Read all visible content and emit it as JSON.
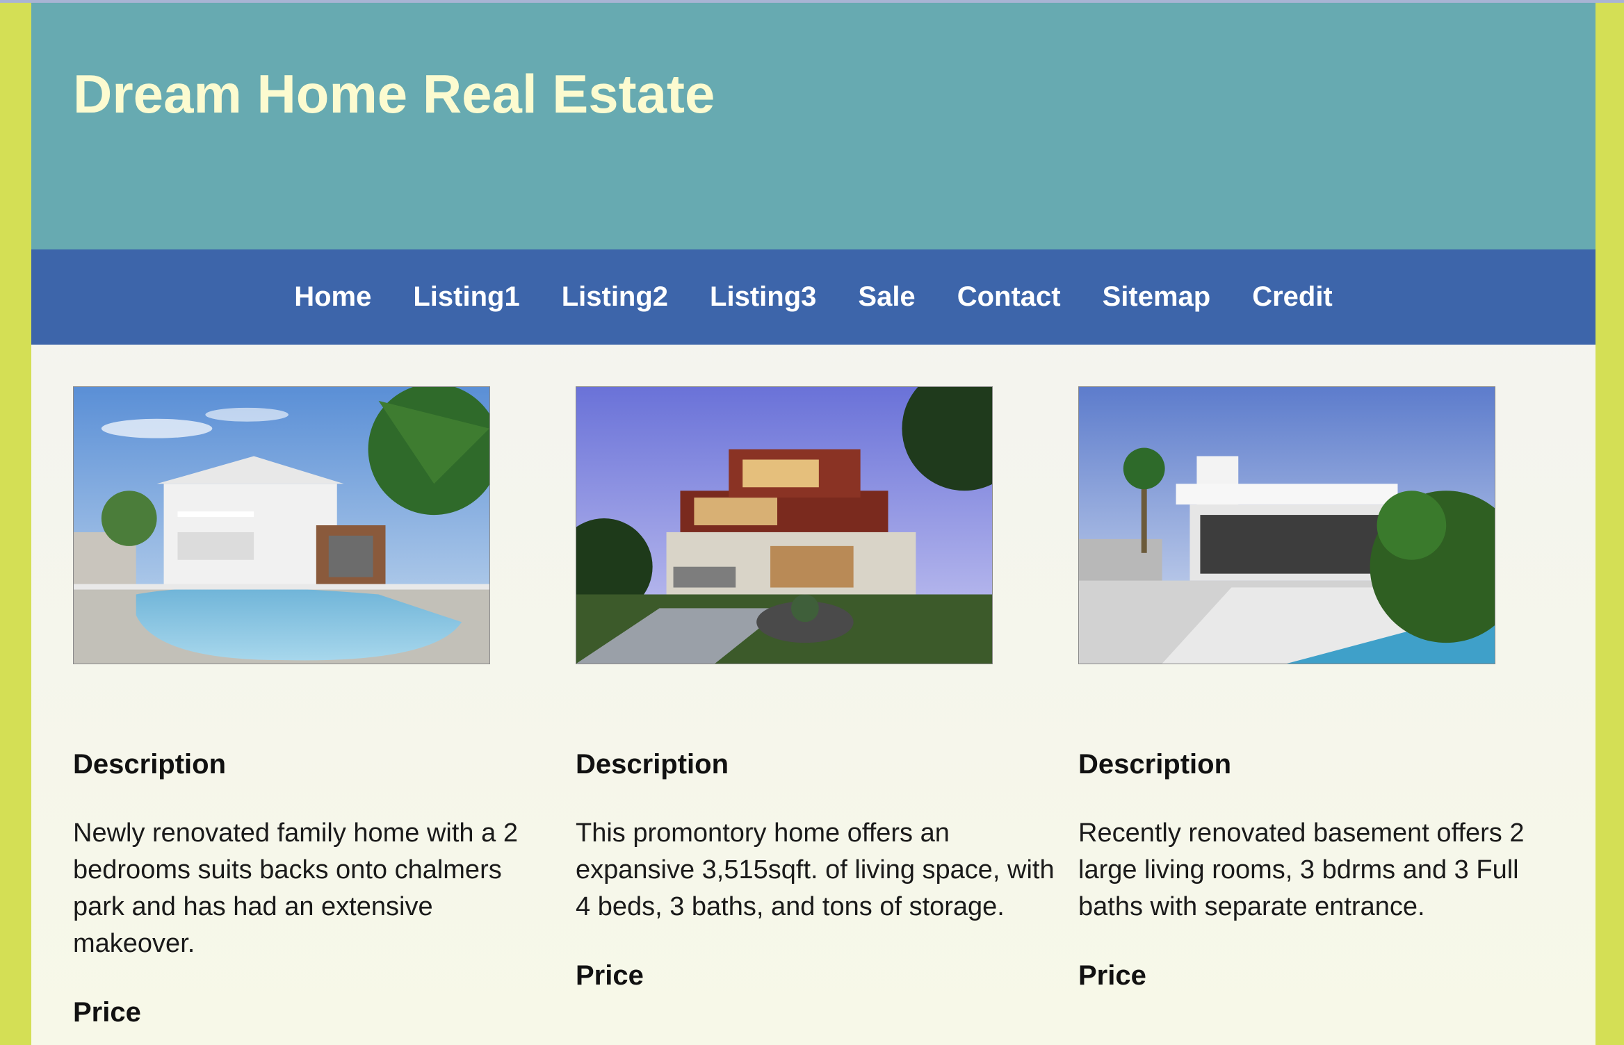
{
  "site": {
    "title": "Dream Home Real Estate"
  },
  "nav": {
    "items": [
      {
        "label": "Home"
      },
      {
        "label": "Listing1"
      },
      {
        "label": "Listing2"
      },
      {
        "label": "Listing3"
      },
      {
        "label": "Sale"
      },
      {
        "label": "Contact"
      },
      {
        "label": "Sitemap"
      },
      {
        "label": "Credit"
      }
    ]
  },
  "listings": [
    {
      "description_heading": "Description",
      "description": "Newly renovated family home with a 2 bedrooms suits backs onto chalmers park and has had an extensive makeover.",
      "price_heading": "Price"
    },
    {
      "description_heading": "Description",
      "description": "This promontory home offers an expansive 3,515sqft. of living space, with 4 beds, 3 baths, and tons of storage.",
      "price_heading": "Price"
    },
    {
      "description_heading": "Description",
      "description": "Recently renovated basement offers 2 large living rooms, 3 bdrms and 3 Full baths with separate entrance.",
      "price_heading": "Price"
    }
  ],
  "colors": {
    "outer_background": "#d4df55",
    "header_background": "#67aab1",
    "title_color": "#fcfbd0",
    "nav_background": "#3d65aa",
    "nav_text": "#ffffff"
  }
}
